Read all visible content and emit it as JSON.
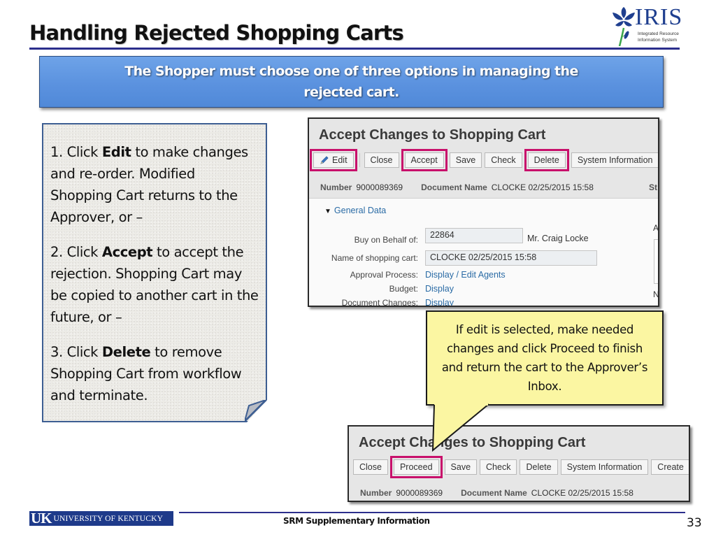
{
  "slide": {
    "title": "Handling Rejected Shopping Carts",
    "logo": {
      "name": "IRIS",
      "subtitle_line1": "Integrated Resource",
      "subtitle_line2": "Information System"
    },
    "banner_text": "The Shopper must choose one of three options in managing the rejected cart."
  },
  "instructions": [
    {
      "prefix": "1. Click ",
      "action": "Edit",
      "suffix": " to make changes and re-order. Modified Shopping Cart returns to the Approver, or –"
    },
    {
      "prefix": "2. Click ",
      "action": "Accept",
      "suffix": " to accept the rejection. Shopping Cart may be copied to another cart in the future, or –"
    },
    {
      "prefix": "3. Click ",
      "action": "Delete",
      "suffix": " to remove Shopping Cart from workflow and terminate."
    }
  ],
  "sap_top": {
    "title": "Accept Changes to Shopping Cart",
    "toolbar": [
      {
        "label": "Edit",
        "icon": "pencil-icon",
        "highlighted": true
      },
      {
        "label": "Close",
        "highlighted": false
      },
      {
        "label": "Accept",
        "highlighted": true
      },
      {
        "label": "Save",
        "highlighted": false
      },
      {
        "label": "Check",
        "highlighted": false
      },
      {
        "label": "Delete",
        "highlighted": true
      },
      {
        "label": "System Information",
        "highlighted": false
      }
    ],
    "meta": {
      "number_label": "Number",
      "number_value": "9000089369",
      "docname_label": "Document Name",
      "docname_value": "CLOCKE 02/25/2015 15:58",
      "status_label_cut": "St"
    },
    "general_data": {
      "header": "General Data",
      "buy_on_behalf_label": "Buy on Behalf of:",
      "buy_on_behalf_value": "22864",
      "buy_on_behalf_name": "Mr. Craig Locke",
      "cart_name_label": "Name of shopping cart:",
      "cart_name_value": "CLOCKE 02/25/2015 15:58",
      "approval_label": "Approval Process:",
      "approval_link": "Display / Edit Agents",
      "budget_label": "Budget:",
      "budget_link": "Display",
      "doc_changes_label": "Document Changes:",
      "doc_changes_link": "Display",
      "side_label_a": "A",
      "side_label_n": "N"
    }
  },
  "callout_text": "If edit is selected, make needed changes and click Proceed to finish and return the cart to the Approver’s Inbox.",
  "sap_bottom": {
    "title": "Accept Changes to Shopping Cart",
    "toolbar": [
      {
        "label": "Close",
        "highlighted": false
      },
      {
        "label": "Proceed",
        "highlighted": true
      },
      {
        "label": "Save",
        "highlighted": false
      },
      {
        "label": "Check",
        "highlighted": false
      },
      {
        "label": "Delete",
        "highlighted": false
      },
      {
        "label": "System Information",
        "highlighted": false
      },
      {
        "label": "Create",
        "highlighted": false
      }
    ],
    "meta": {
      "number_label": "Number",
      "number_value": "9000089369",
      "docname_label": "Document Name",
      "docname_value": "CLOCKE 02/25/2015 15:58"
    }
  },
  "footer": {
    "uk_mark": "UK",
    "university": "UNIVERSITY OF KENTUCKY",
    "center_text": "SRM Supplementary Information",
    "page_number": "33"
  },
  "colors": {
    "highlight": "#c8106b",
    "banner_blue": "#5b92df",
    "rule_navy": "#2b2e8c",
    "callout_yellow": "#fbf6a2",
    "link_blue": "#2a6ba5"
  }
}
